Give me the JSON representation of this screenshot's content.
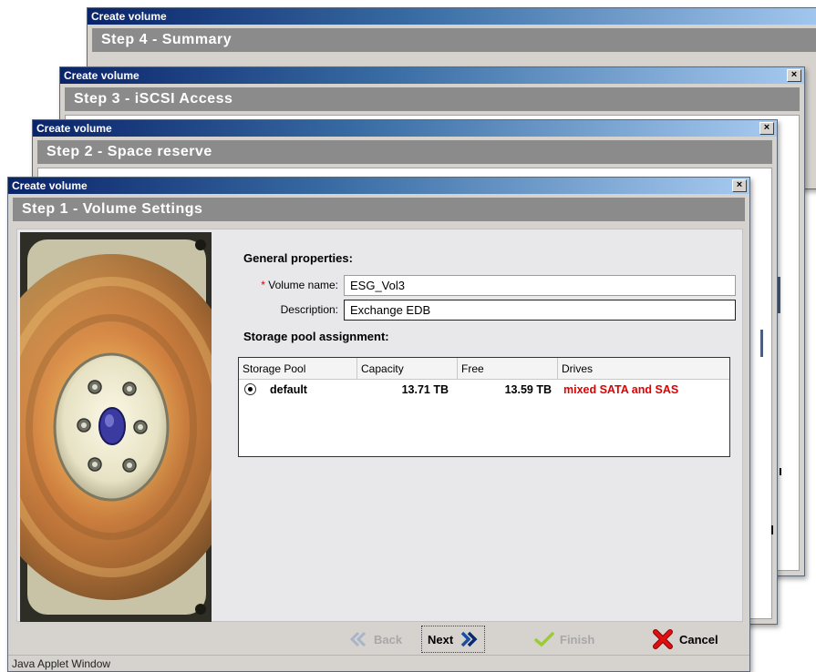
{
  "dialogs": {
    "step4": {
      "title": "Create volume",
      "step": "Step 4 - Summary"
    },
    "step3": {
      "title": "Create volume",
      "step": "Step 3 - iSCSI Access"
    },
    "step2": {
      "title": "Create volume",
      "step": "Step 2 - Space reserve"
    },
    "step1": {
      "title": "Create volume",
      "step": "Step 1 - Volume Settings"
    }
  },
  "close_glyph": "×",
  "form": {
    "general_heading": "General properties:",
    "required_marker": "*",
    "volume_name_label": "Volume name:",
    "volume_name_value": "ESG_Vol3",
    "description_label": "Description:",
    "description_value": "Exchange EDB",
    "pool_heading": "Storage pool assignment:"
  },
  "pool_table": {
    "columns": [
      "Storage Pool",
      "Capacity",
      "Free",
      "Drives"
    ],
    "rows": [
      {
        "pool": "default",
        "capacity": "13.71 TB",
        "free": "13.59 TB",
        "drives": "mixed SATA and SAS",
        "selected": true
      }
    ]
  },
  "buttons": {
    "back": "Back",
    "next": "Next",
    "finish": "Finish",
    "cancel": "Cancel"
  },
  "status_text": "Java Applet Window",
  "colors": {
    "title_start": "#0a246a",
    "step_bar": "#8b8b8b",
    "drives_warning": "#e00000",
    "cancel_x": "#d40000",
    "finish_check": "#9acd32",
    "next_arrow": "#1a4fa0"
  }
}
